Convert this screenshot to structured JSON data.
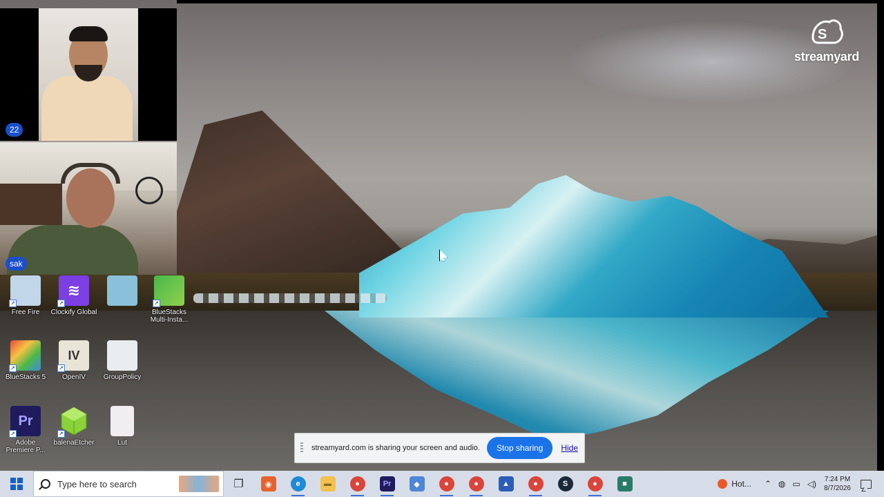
{
  "participants": [
    {
      "badge": "22"
    },
    {
      "badge": "sak"
    }
  ],
  "brand": {
    "name": "streamyard",
    "logo_icon": "streamyard-logo-icon"
  },
  "desktop_icons": [
    {
      "label": "Free Fire",
      "icon": "free-fire-icon",
      "color": "#c2d6ea"
    },
    {
      "label": "Clockify Global",
      "icon": "clockify-icon",
      "color": "#7b3fe4"
    },
    {
      "label": "",
      "icon": "app-icon",
      "color": "#8ac0d9"
    },
    {
      "label": "BlueStacks Multi-Insta...",
      "icon": "bluestacks-multi-instance-icon",
      "color": "#48b749"
    },
    {
      "label": "BlueStacks 5",
      "icon": "bluestacks-icon",
      "color": "#3c8de0"
    },
    {
      "label": "OpenIV",
      "icon": "openiv-icon",
      "color": "#e8e4d8"
    },
    {
      "label": "GroupPolicy",
      "icon": "file-icon",
      "color": "#e9ecef"
    },
    {
      "label": "Adobe Premiere P...",
      "icon": "premiere-pro-icon",
      "color": "#1f1b5c"
    },
    {
      "label": "balenaEtcher",
      "icon": "balena-etcher-icon",
      "color": "#8bd23a"
    },
    {
      "label": "Lut",
      "icon": "file-icon",
      "color": "#f0eef0"
    }
  ],
  "share_bar": {
    "message": "streamyard.com is sharing your screen and audio.",
    "stop_label": "Stop sharing",
    "hide_label": "Hide"
  },
  "taskbar": {
    "search_placeholder": "Type here to search",
    "apps": [
      {
        "icon": "task-view-icon",
        "color": "#444444",
        "glyph": "❐"
      },
      {
        "icon": "browser-icon",
        "color": "#e8622c",
        "glyph": "◉"
      },
      {
        "icon": "edge-icon",
        "color": "#1f8ad6",
        "glyph": "e"
      },
      {
        "icon": "file-explorer-icon",
        "color": "#f2c14e",
        "glyph": "▬"
      },
      {
        "icon": "chrome-icon",
        "color": "#d9453b",
        "glyph": "●"
      },
      {
        "icon": "premiere-pro-icon",
        "color": "#1f1b5c",
        "glyph": "Pr"
      },
      {
        "icon": "app-icon",
        "color": "#4f86d6",
        "glyph": "◆"
      },
      {
        "icon": "chrome-icon",
        "color": "#d9453b",
        "glyph": "●"
      },
      {
        "icon": "chrome-icon",
        "color": "#d9453b",
        "glyph": "●"
      },
      {
        "icon": "app-icon",
        "color": "#2c5db8",
        "glyph": "▲"
      },
      {
        "icon": "chrome-icon",
        "color": "#d9453b",
        "glyph": "●"
      },
      {
        "icon": "steam-icon",
        "color": "#1b2838",
        "glyph": "S"
      },
      {
        "icon": "chrome-icon",
        "color": "#d9453b",
        "glyph": "●"
      },
      {
        "icon": "app-icon",
        "color": "#2a7a6a",
        "glyph": "■"
      }
    ],
    "weather_label": "Hot...",
    "time": "7:24 PM",
    "date": "8/7/2026"
  }
}
